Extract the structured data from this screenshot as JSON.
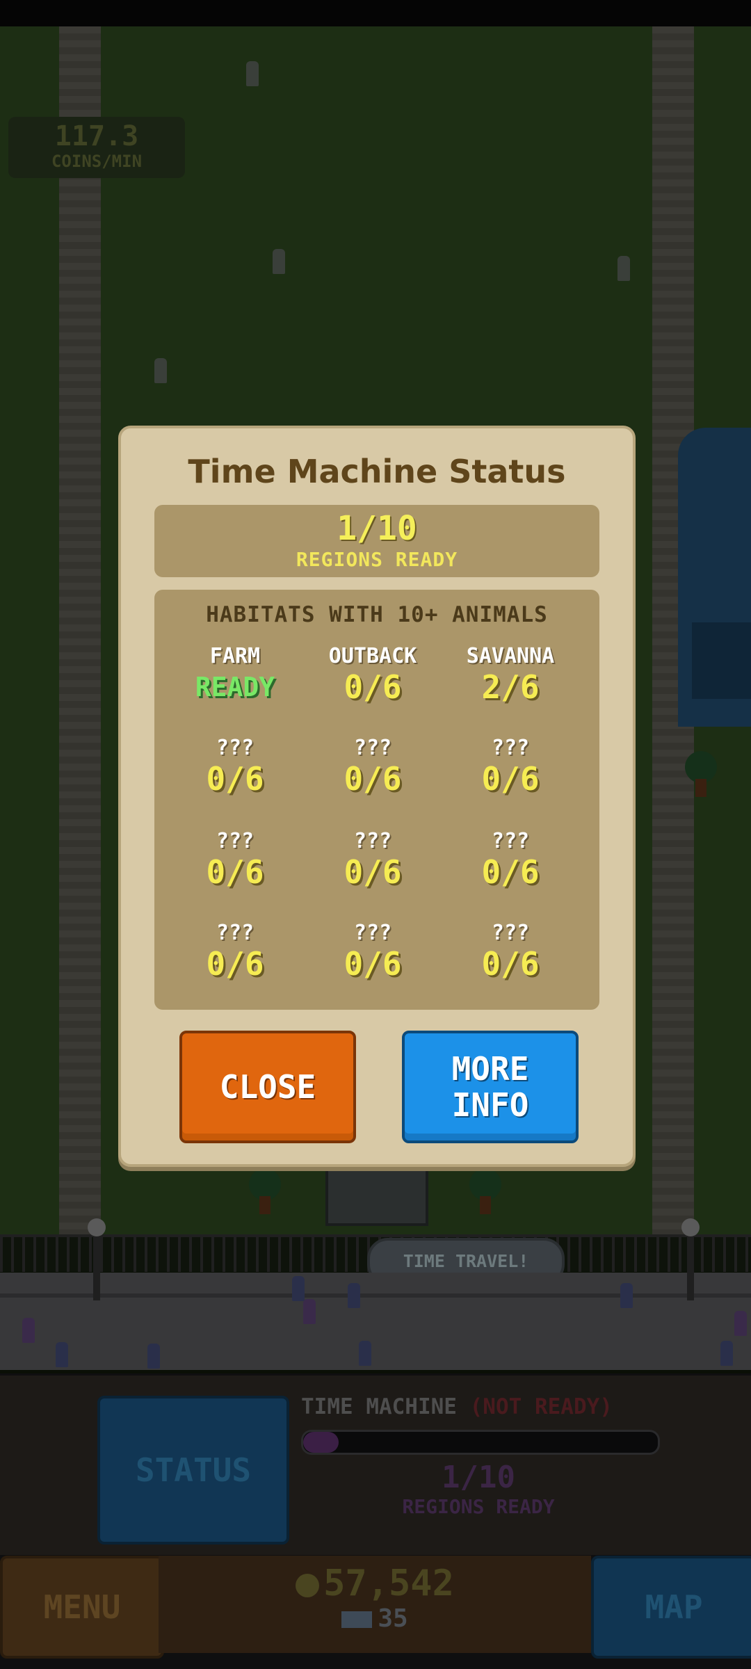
{
  "background": {
    "coins_per_min_value": "117.3",
    "coins_per_min_label": "COINS/MIN",
    "time_travel_sign": "TIME TRAVEL!"
  },
  "modal": {
    "title": "Time Machine Status",
    "regions_ready_count": "1/10",
    "regions_ready_label": "REGIONS READY",
    "habitats_header": "HABITATS WITH 10+ ANIMALS",
    "habitats": [
      {
        "name": "FARM",
        "value": "READY",
        "ready": true
      },
      {
        "name": "OUTBACK",
        "value": "0/6"
      },
      {
        "name": "SAVANNA",
        "value": "2/6"
      },
      {
        "name": "???",
        "value": "0/6"
      },
      {
        "name": "???",
        "value": "0/6"
      },
      {
        "name": "???",
        "value": "0/6"
      },
      {
        "name": "???",
        "value": "0/6"
      },
      {
        "name": "???",
        "value": "0/6"
      },
      {
        "name": "???",
        "value": "0/6"
      },
      {
        "name": "???",
        "value": "0/6"
      },
      {
        "name": "???",
        "value": "0/6"
      },
      {
        "name": "???",
        "value": "0/6"
      }
    ],
    "close_label": "CLOSE",
    "more_info_line1": "MORE",
    "more_info_line2": "INFO"
  },
  "hud": {
    "status_label": "STATUS",
    "time_machine_label": "TIME MACHINE",
    "not_ready_label": "(NOT READY)",
    "progress_fraction": 0.1,
    "regions_count": "1/10",
    "regions_label": "REGIONS READY",
    "menu_label": "MENU",
    "map_label": "MAP",
    "coins": "57,542",
    "tickets": "35"
  },
  "colors": {
    "ready_green": "#79e866",
    "value_yellow": "#f6ec53",
    "close_orange": "#e0660e",
    "info_blue": "#1c91e8"
  }
}
